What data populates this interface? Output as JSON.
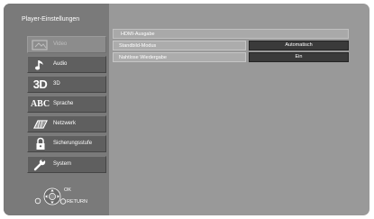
{
  "window": {
    "title": "Player-Einstellungen"
  },
  "sidebar": {
    "items": [
      {
        "label": "Video",
        "icon": "video-icon",
        "dimmed": true
      },
      {
        "label": "Audio",
        "icon": "music-note-icon"
      },
      {
        "label": "3D",
        "icon_text": "3D"
      },
      {
        "label": "Sprache",
        "icon_text": "ABC"
      },
      {
        "label": "Netzwerk",
        "icon": "network-icon"
      },
      {
        "label": "Sicherungsstufe",
        "icon": "lock-icon"
      },
      {
        "label": "System",
        "icon": "wrench-icon"
      }
    ]
  },
  "remote_hint": {
    "ok_label": "OK",
    "return_label": "RETURN"
  },
  "settings": {
    "header": "HDMI-Ausgabe",
    "rows": [
      {
        "label": "Standbild-Modus",
        "value": "Automatisch"
      },
      {
        "label": "Nahtlose Wiedergabe",
        "value": "Ein"
      }
    ]
  },
  "colors": {
    "screen_bg": "#999999",
    "sidebar_bg": "#7a7a7a",
    "menu_item_bg": "#5f5f5f",
    "value_bg": "#3a3a3a"
  }
}
